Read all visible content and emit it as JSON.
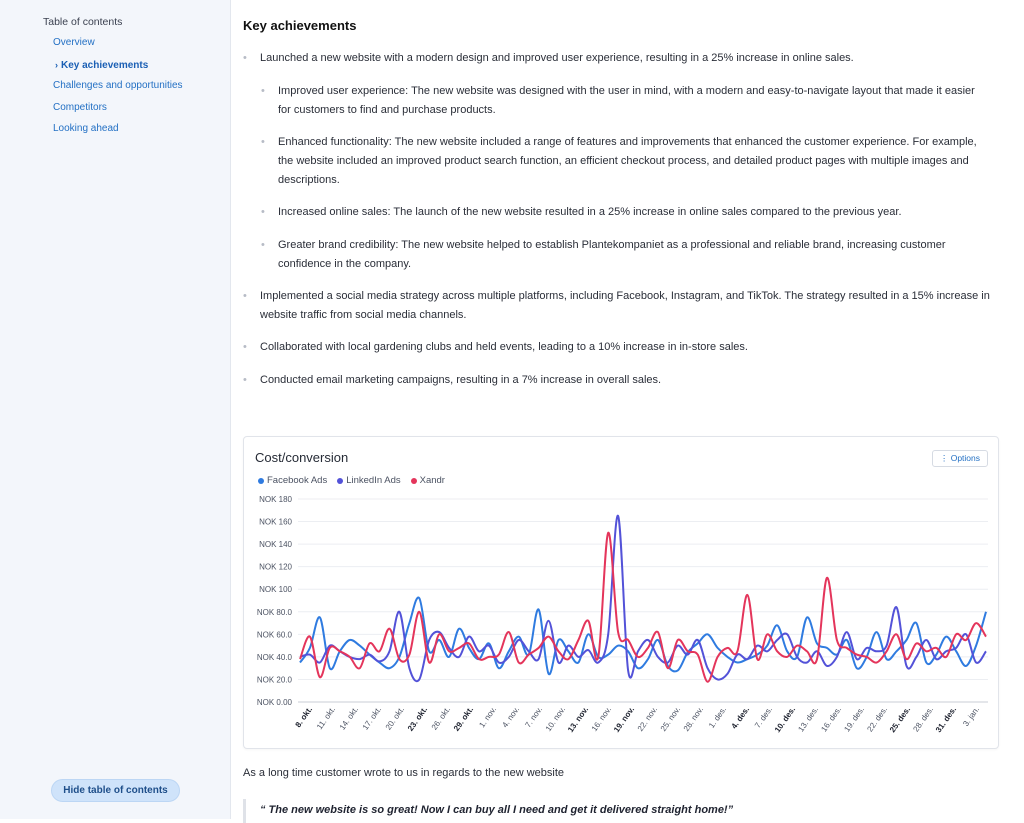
{
  "toc": {
    "title": "Table of contents",
    "items": [
      {
        "label": "Overview",
        "active": false
      },
      {
        "label": "Key achievements",
        "active": true
      },
      {
        "label": "Challenges and opportunities",
        "active": false
      },
      {
        "label": "Competitors",
        "active": false
      },
      {
        "label": "Looking ahead",
        "active": false
      }
    ],
    "hide_button": "Hide table of contents"
  },
  "section": {
    "heading": "Key achievements",
    "bullets": [
      "Launched a new website with a modern design and improved user experience, resulting in a 25% increase in online sales.",
      "Improved user experience: The new website was designed with the user in mind, with a modern and easy-to-navigate layout that made it easier for customers to find and purchase products.",
      "Enhanced functionality: The new website included a range of features and improvements that enhanced the customer experience. For example, the website included an improved product search function, an efficient checkout process, and detailed product pages with multiple images and descriptions.",
      "Increased online sales: The launch of the new website resulted in a 25% increase in online sales compared to the previous year.",
      "Greater brand credibility: The new website helped to establish Plantekompaniet as a professional and reliable brand, increasing customer confidence in the company.",
      "Implemented a social media strategy across multiple platforms, including Facebook, Instagram, and TikTok. The strategy resulted in a 15% increase in website traffic from social media channels.",
      "Collaborated with local gardening clubs and held events, leading to a 10% increase in in-store sales.",
      "Conducted email marketing campaigns, resulting in a 7% increase in overall sales."
    ],
    "after_chart": "As a long time customer wrote to us in regards to the new website",
    "quote": "“ The new website is so great! Now I can buy all I need and get it delivered straight home!”"
  },
  "chart": {
    "options_label": "⋮ Options",
    "options_icon": "kebab-menu-icon"
  },
  "chart_data": {
    "type": "line",
    "title": "Cost/conversion",
    "ylim": [
      0,
      180
    ],
    "y_ticks": [
      "NOK 0.00",
      "NOK 20.0",
      "NOK 40.0",
      "NOK 60.0",
      "NOK 80.0",
      "NOK 100",
      "NOK 120",
      "NOK 140",
      "NOK 160",
      "NOK 180"
    ],
    "x_ticks": [
      {
        "label": "8. okt.",
        "bold": true
      },
      {
        "label": "11. okt.",
        "bold": false
      },
      {
        "label": "14. okt.",
        "bold": false
      },
      {
        "label": "17. okt.",
        "bold": false
      },
      {
        "label": "20. okt.",
        "bold": false
      },
      {
        "label": "23. okt.",
        "bold": true
      },
      {
        "label": "26. okt.",
        "bold": false
      },
      {
        "label": "29. okt.",
        "bold": true
      },
      {
        "label": "1. nov.",
        "bold": false
      },
      {
        "label": "4. nov.",
        "bold": false
      },
      {
        "label": "7. nov.",
        "bold": false
      },
      {
        "label": "10. nov.",
        "bold": false
      },
      {
        "label": "13. nov.",
        "bold": true
      },
      {
        "label": "16. nov.",
        "bold": false
      },
      {
        "label": "19. nov.",
        "bold": true
      },
      {
        "label": "22. nov.",
        "bold": false
      },
      {
        "label": "25. nov.",
        "bold": false
      },
      {
        "label": "28. nov.",
        "bold": false
      },
      {
        "label": "1. des.",
        "bold": false
      },
      {
        "label": "4. des.",
        "bold": true
      },
      {
        "label": "7. des.",
        "bold": false
      },
      {
        "label": "10. des.",
        "bold": true
      },
      {
        "label": "13. des.",
        "bold": false
      },
      {
        "label": "16. des.",
        "bold": false
      },
      {
        "label": "19. des.",
        "bold": false
      },
      {
        "label": "22. des.",
        "bold": false
      },
      {
        "label": "25. des.",
        "bold": true
      },
      {
        "label": "28. des.",
        "bold": false
      },
      {
        "label": "31. des.",
        "bold": true
      },
      {
        "label": "3. jan.",
        "bold": false
      }
    ],
    "grid": true,
    "legend": "top-left",
    "series": [
      {
        "name": "Facebook Ads",
        "color": "#2f7be0",
        "values": [
          35,
          48,
          75,
          30,
          45,
          55,
          50,
          42,
          35,
          30,
          40,
          70,
          92,
          45,
          55,
          40,
          65,
          48,
          38,
          52,
          30,
          45,
          58,
          42,
          82,
          25,
          55,
          45,
          35,
          60,
          40,
          42,
          50,
          45,
          30,
          38,
          55,
          32,
          28,
          44,
          52,
          60,
          48,
          40,
          35,
          38,
          42,
          50,
          68,
          45,
          40,
          75,
          52,
          48,
          42,
          55,
          30,
          40,
          62,
          38,
          45,
          55,
          70,
          35,
          42,
          58,
          45,
          32,
          50,
          80
        ]
      },
      {
        "name": "LinkedIn Ads",
        "color": "#5352d8",
        "values": [
          40,
          42,
          35,
          50,
          45,
          40,
          38,
          42,
          36,
          45,
          80,
          30,
          20,
          55,
          62,
          48,
          40,
          58,
          45,
          50,
          35,
          40,
          55,
          45,
          38,
          72,
          35,
          50,
          40,
          46,
          35,
          60,
          165,
          28,
          45,
          55,
          40,
          35,
          50,
          42,
          55,
          30,
          20,
          25,
          42,
          38,
          50,
          45,
          55,
          60,
          40,
          35,
          45,
          32,
          40,
          62,
          38,
          48,
          45,
          50,
          84,
          32,
          40,
          55,
          38,
          45,
          48,
          60,
          35,
          45
        ]
      },
      {
        "name": "Xandr",
        "color": "#e4355b",
        "values": [
          38,
          58,
          22,
          48,
          45,
          40,
          30,
          52,
          45,
          65,
          38,
          42,
          80,
          35,
          60,
          45,
          48,
          52,
          38,
          40,
          42,
          62,
          35,
          42,
          48,
          58,
          45,
          38,
          55,
          72,
          40,
          150,
          62,
          55,
          40,
          48,
          62,
          30,
          55,
          45,
          42,
          18,
          40,
          48,
          45,
          95,
          38,
          60,
          45,
          40,
          50,
          45,
          38,
          110,
          55,
          48,
          42,
          40,
          35,
          45,
          60,
          38,
          52,
          45,
          48,
          40,
          60,
          55,
          70,
          58
        ]
      }
    ]
  }
}
